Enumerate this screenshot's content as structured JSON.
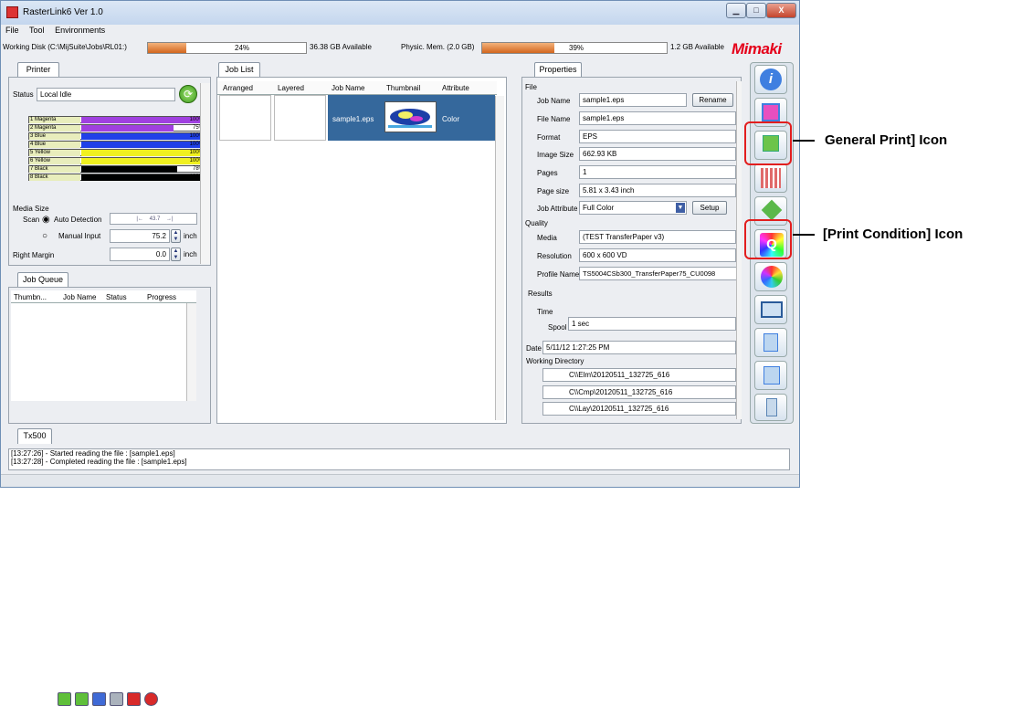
{
  "window": {
    "title": "RasterLink6 Ver 1.0",
    "min": "▁",
    "max": "□",
    "close": "X"
  },
  "menu": [
    "File",
    "Tool",
    "Environments"
  ],
  "status": {
    "working_disk": "Working Disk (C:\\MijSuite\\Jobs\\RL01:)",
    "disk_pct": "24%",
    "disk_progress": 24,
    "disk_avail": "36.38 GB Available",
    "phys_mem": "Physic. Mem. (2.0 GB)",
    "mem_pct": "39%",
    "mem_progress": 39,
    "mem_avail": "1.2 GB Available",
    "logo": "Mimaki"
  },
  "printer": {
    "tab": "Printer",
    "status_label": "Status",
    "status_value": "Local Idle",
    "inks": [
      {
        "name": "1 Magenta",
        "pct": "100%",
        "level": 1.0,
        "color": "#a040e0"
      },
      {
        "name": "2 Magenta",
        "pct": "75%",
        "level": 0.75,
        "color": "#a040e0"
      },
      {
        "name": "3 Blue",
        "pct": "100%",
        "level": 1.0,
        "color": "#2040e8"
      },
      {
        "name": "4 Blue",
        "pct": "100%",
        "level": 1.0,
        "color": "#2040e8"
      },
      {
        "name": "5 Yellow",
        "pct": "100%",
        "level": 1.0,
        "color": "#f0f020"
      },
      {
        "name": "6 Yellow",
        "pct": "100%",
        "level": 1.0,
        "color": "#f0f020"
      },
      {
        "name": "7 Black",
        "pct": "78%",
        "level": 0.78,
        "color": "#000000"
      },
      {
        "name": "8 Black",
        "pct": "100%",
        "level": 1.0,
        "color": "#000000"
      }
    ],
    "media_size": "Media Size",
    "scan": "Scan",
    "auto_detection": "Auto Detection",
    "auto_value": "43.7",
    "manual_input": "Manual Input",
    "manual_value": "75.2",
    "unit": "inch",
    "right_margin": "Right Margin",
    "margin_value": "0.0"
  },
  "queue": {
    "tab": "Job Queue",
    "columns": [
      "Thumbn...",
      "Job Name",
      "Status",
      "Progress"
    ]
  },
  "joblist": {
    "tab": "Job List",
    "columns": [
      "Arranged",
      "Layered",
      "Job Name",
      "Thumbnail",
      "Attribute"
    ],
    "row": {
      "job_name": "sample1.eps",
      "attribute": "Color"
    }
  },
  "properties": {
    "tab": "Properties",
    "file_section": "File",
    "job_name_label": "Job Name",
    "job_name": "sample1.eps",
    "rename": "Rename",
    "file_name_label": "File Name",
    "file_name": "sample1.eps",
    "format_label": "Format",
    "format": "EPS",
    "image_size_label": "Image Size",
    "image_size": "662.93 KB",
    "pages_label": "Pages",
    "pages": "1",
    "page_size_label": "Page size",
    "page_size": "5.81 x 3.43 inch",
    "job_attr_label": "Job Attribute",
    "job_attr": "Full Color",
    "setup": "Setup",
    "quality_section": "Quality",
    "media_label": "Media",
    "media": "(TEST TransferPaper v3)",
    "resolution_label": "Resolution",
    "resolution": "600 x 600 VD",
    "profile_label": "Profile Name",
    "profile": "TS5004CSb300_TransferPaper75_CU0098",
    "results_section": "Results",
    "time_label": "Time",
    "spool_label": "Spool",
    "spool": "1 sec",
    "date_label": "Date",
    "date": "5/11/12 1:27:25 PM",
    "workdir_label": "Working Directory",
    "dirs": [
      "C\\\\Elm\\20120511_132725_616",
      "C\\\\Cmp\\20120511_132725_616",
      "C\\\\Lay\\20120511_132725_616"
    ]
  },
  "bottom": {
    "tab": "Tx500",
    "log": [
      "[13:27:26] - Started reading the file : [sample1.eps]",
      "[13:27:28] - Completed reading the file : [sample1.eps]"
    ]
  },
  "callouts": {
    "general_print": "General Print] Icon",
    "print_condition": "[Print Condition] Icon"
  },
  "colors": {
    "accent": "#e21e1e",
    "selected_row": "#35689c",
    "logo": "#e5001a"
  }
}
